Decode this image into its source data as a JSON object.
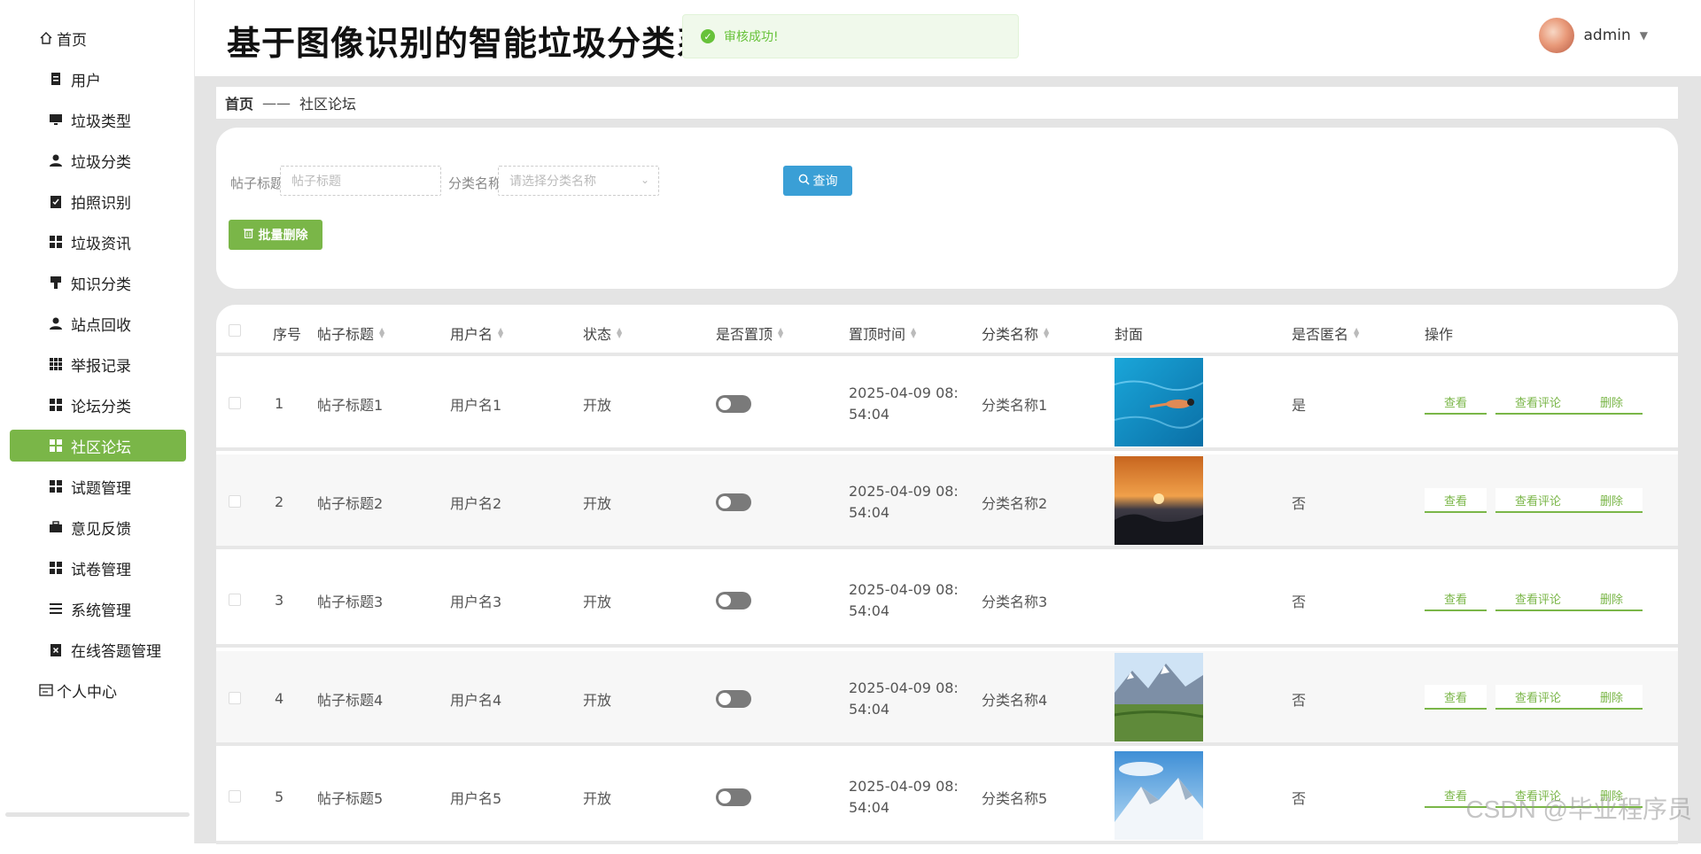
{
  "sidebar": {
    "items": [
      {
        "label": "首页",
        "icon": "home-icon",
        "level": "top"
      },
      {
        "label": "用户",
        "icon": "document-icon",
        "level": "sub"
      },
      {
        "label": "垃圾类型",
        "icon": "monitor-icon",
        "level": "sub"
      },
      {
        "label": "垃圾分类",
        "icon": "person-icon",
        "level": "sub"
      },
      {
        "label": "拍照识别",
        "icon": "clipboard-check-icon",
        "level": "sub"
      },
      {
        "label": "垃圾资讯",
        "icon": "grid-icon",
        "level": "sub"
      },
      {
        "label": "知识分类",
        "icon": "brush-icon",
        "level": "sub"
      },
      {
        "label": "站点回收",
        "icon": "person-icon",
        "level": "sub"
      },
      {
        "label": "举报记录",
        "icon": "grid9-icon",
        "level": "sub"
      },
      {
        "label": "论坛分类",
        "icon": "grid-icon",
        "level": "sub"
      },
      {
        "label": "社区论坛",
        "icon": "grid-icon",
        "level": "sub",
        "active": true
      },
      {
        "label": "试题管理",
        "icon": "grid-icon",
        "level": "sub"
      },
      {
        "label": "意见反馈",
        "icon": "briefcase-icon",
        "level": "sub"
      },
      {
        "label": "试卷管理",
        "icon": "grid-icon",
        "level": "sub"
      },
      {
        "label": "系统管理",
        "icon": "list-icon",
        "level": "sub"
      },
      {
        "label": "在线答题管理",
        "icon": "clipboard-x-icon",
        "level": "sub"
      },
      {
        "label": "个人中心",
        "icon": "id-card-icon",
        "level": "top"
      }
    ]
  },
  "header": {
    "title": "基于图像识别的智能垃圾分类系统",
    "user": "admin"
  },
  "toast": {
    "message": "审核成功!"
  },
  "breadcrumb": {
    "home": "首页",
    "separator": "——",
    "current": "社区论坛"
  },
  "search": {
    "title_label": "帖子标题",
    "title_placeholder": "帖子标题",
    "category_label": "分类名称",
    "category_placeholder": "请选择分类名称",
    "query_label": "查询",
    "batch_delete_label": "批量删除"
  },
  "table": {
    "columns": [
      "序号",
      "帖子标题",
      "用户名",
      "状态",
      "是否置顶",
      "置顶时间",
      "分类名称",
      "封面",
      "是否匿名",
      "操作"
    ],
    "actions": [
      "查看",
      "查看评论",
      "删除"
    ],
    "rows": [
      {
        "index": "1",
        "title": "帖子标题1",
        "username": "用户名1",
        "status": "开放",
        "pinned": false,
        "time_line1": "2025-04-09 08:",
        "time_line2": "54:04",
        "category": "分类名称1",
        "cover": "swimmer",
        "anonymous": "是"
      },
      {
        "index": "2",
        "title": "帖子标题2",
        "username": "用户名2",
        "status": "开放",
        "pinned": false,
        "time_line1": "2025-04-09 08:",
        "time_line2": "54:04",
        "category": "分类名称2",
        "cover": "sunset",
        "anonymous": "否"
      },
      {
        "index": "3",
        "title": "帖子标题3",
        "username": "用户名3",
        "status": "开放",
        "pinned": false,
        "time_line1": "2025-04-09 08:",
        "time_line2": "54:04",
        "category": "分类名称3",
        "cover": "none",
        "anonymous": "否"
      },
      {
        "index": "4",
        "title": "帖子标题4",
        "username": "用户名4",
        "status": "开放",
        "pinned": false,
        "time_line1": "2025-04-09 08:",
        "time_line2": "54:04",
        "category": "分类名称4",
        "cover": "mountain-meadow",
        "anonymous": "否"
      },
      {
        "index": "5",
        "title": "帖子标题5",
        "username": "用户名5",
        "status": "开放",
        "pinned": false,
        "time_line1": "2025-04-09 08:",
        "time_line2": "54:04",
        "category": "分类名称5",
        "cover": "snow-mountain",
        "anonymous": "否"
      }
    ]
  },
  "watermark": "CSDN @毕业程序员",
  "colors": {
    "accent": "#7ab648",
    "query_button": "#3a9fd6",
    "toast_text": "#67c23a"
  }
}
